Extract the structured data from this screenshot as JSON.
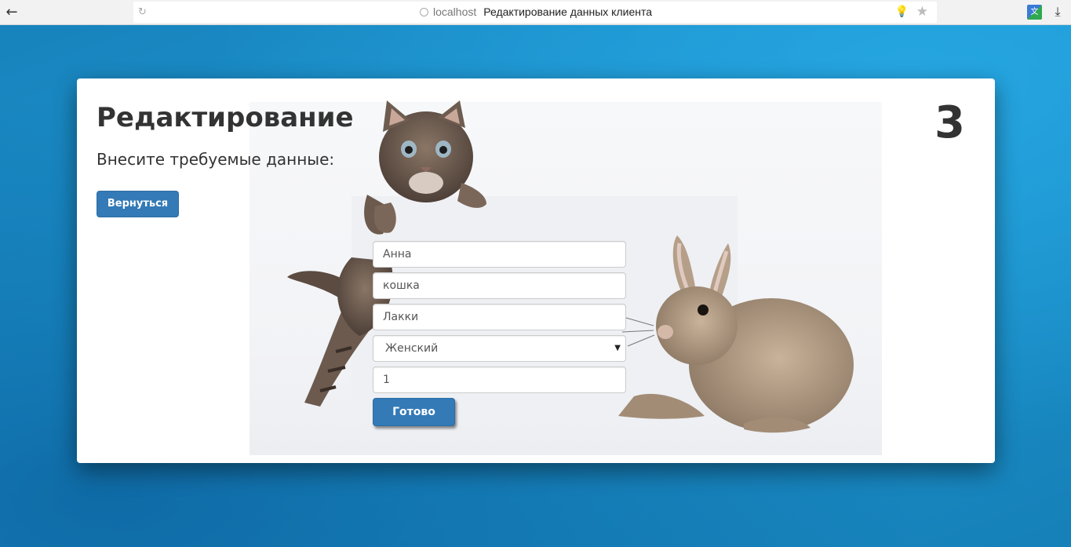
{
  "browser": {
    "back_glyph": "←",
    "reload_glyph": "↻",
    "host": "localhost",
    "tab_title": "Редактирование данных клиента",
    "bulb_glyph": "💡",
    "star_glyph": "★",
    "translate_glyph": "文",
    "download_glyph": "⤓"
  },
  "page": {
    "title": "Редактирование",
    "subtitle": "Внесите требуемые данные:",
    "back_label": "Вернуться",
    "client_number": "3"
  },
  "form": {
    "name_value": "Анна",
    "species_value": "кошка",
    "pet_name_value": "Лакки",
    "gender_selected": "Женский",
    "age_value": "1",
    "submit_label": "Готово"
  },
  "colors": {
    "primary_button": "#337ab7",
    "background": "#1a8ec4"
  },
  "icons": [
    "back-arrow-icon",
    "reload-icon",
    "globe-icon",
    "bulb-icon",
    "star-icon",
    "translate-icon",
    "download-icon",
    "chevron-down-icon"
  ]
}
